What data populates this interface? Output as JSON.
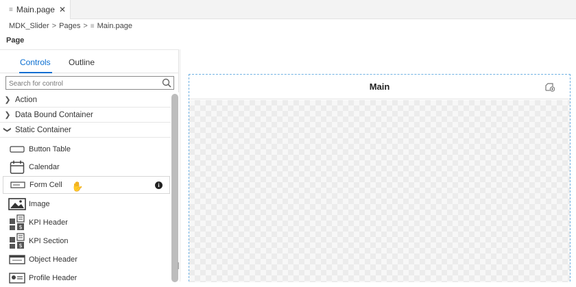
{
  "editor_tab": {
    "label": "Main.page",
    "close_glyph": "✕",
    "icon": "file-lines-icon"
  },
  "breadcrumb": {
    "items": [
      "MDK_Slider",
      "Pages",
      "Main.page"
    ],
    "separator": ">"
  },
  "section_label": "Page",
  "panel": {
    "tabs": [
      {
        "label": "Controls",
        "active": true
      },
      {
        "label": "Outline",
        "active": false
      }
    ],
    "search_placeholder": "Search for control",
    "groups": [
      {
        "label": "Action",
        "expanded": false
      },
      {
        "label": "Data Bound Container",
        "expanded": false
      },
      {
        "label": "Static Container",
        "expanded": true
      }
    ],
    "items": [
      {
        "label": "Button Table",
        "icon": "button-table-icon"
      },
      {
        "label": "Calendar",
        "icon": "calendar-icon"
      },
      {
        "label": "Form Cell",
        "icon": "form-cell-icon",
        "selected": true,
        "info": "i"
      },
      {
        "label": "Image",
        "icon": "image-icon"
      },
      {
        "label": "KPI Header",
        "icon": "kpi-header-icon"
      },
      {
        "label": "KPI Section",
        "icon": "kpi-section-icon"
      },
      {
        "label": "Object Header",
        "icon": "object-header-icon"
      },
      {
        "label": "Profile Header",
        "icon": "profile-header-icon"
      }
    ]
  },
  "canvas": {
    "title": "Main",
    "action_icon": "add-page-icon"
  },
  "colors": {
    "accent": "#0a6ed1",
    "canvas_border": "#6fb1e3"
  }
}
